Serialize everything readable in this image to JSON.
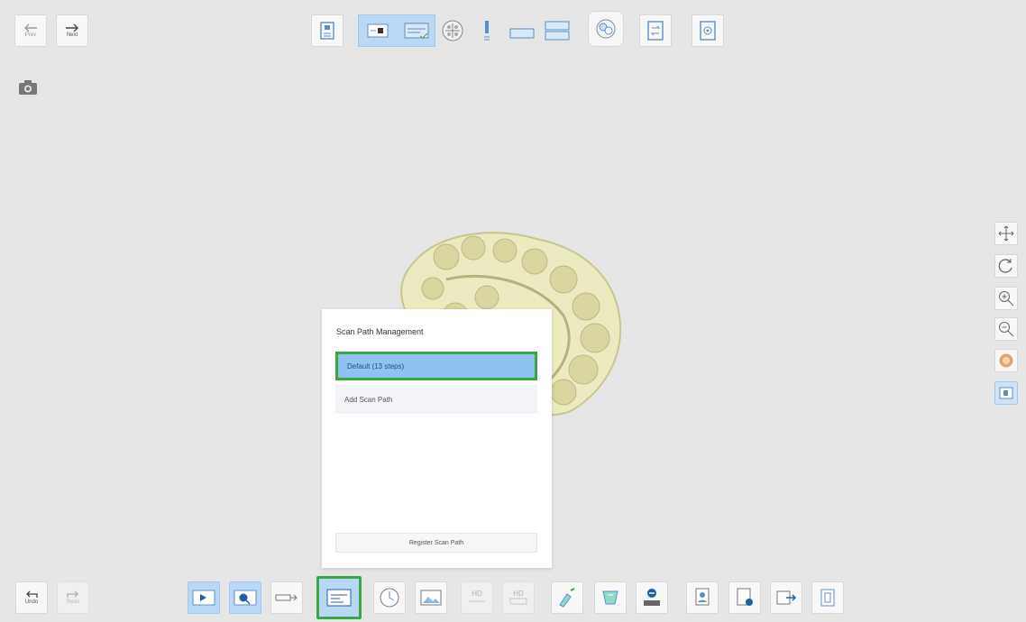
{
  "nav": {
    "prev_label": "Prev",
    "next_label": "Next"
  },
  "top_toolbar": {
    "items": [
      {
        "icon": "scan-info-icon"
      },
      {
        "icon": "single-view-icon",
        "active": true
      },
      {
        "icon": "dual-view-icon",
        "active": true
      },
      {
        "icon": "occlusion-icon"
      },
      {
        "icon": "vertical-bar-icon"
      },
      {
        "icon": "single-jaw-icon"
      },
      {
        "icon": "double-jaw-icon"
      },
      {
        "icon": "scan-align-icon"
      },
      {
        "icon": "swap-icon"
      },
      {
        "icon": "settings-clipboard-icon"
      }
    ]
  },
  "right_toolbar": {
    "items": [
      {
        "icon": "pan-icon"
      },
      {
        "icon": "rotate-icon"
      },
      {
        "icon": "zoom-in-icon"
      },
      {
        "icon": "zoom-out-icon"
      },
      {
        "icon": "texture-icon"
      },
      {
        "icon": "view-mode-icon",
        "active": true
      }
    ]
  },
  "bottom_toolbar": {
    "undo_label": "Undo",
    "redo_label": "Redo",
    "items": [
      {
        "icon": "play-scan-icon",
        "active": true
      },
      {
        "icon": "scan-filter-icon",
        "active": true
      },
      {
        "icon": "arrow-flow-icon"
      },
      {
        "icon": "scan-path-icon",
        "highlighted": true
      },
      {
        "icon": "timer-icon"
      },
      {
        "icon": "image-icon"
      },
      {
        "icon": "hd-icon",
        "label": "HD",
        "disabled": true
      },
      {
        "icon": "hd-plus-icon",
        "label": "HD",
        "disabled": true
      },
      {
        "icon": "trim-icon"
      },
      {
        "icon": "lock-icon"
      },
      {
        "icon": "minus-icon"
      },
      {
        "icon": "user-icon"
      },
      {
        "icon": "report-icon"
      },
      {
        "icon": "file-settings-icon"
      },
      {
        "icon": "export-icon"
      },
      {
        "icon": "delete-icon"
      }
    ]
  },
  "panel": {
    "title": "Scan Path Management",
    "paths": [
      {
        "label": "Default (13 steps)",
        "selected": true
      },
      {
        "label": "Add Scan Path"
      }
    ],
    "register_label": "Register Scan Path"
  },
  "colors": {
    "background": "#e6e6e6",
    "accent_blue": "#8ec2f1",
    "highlight_green": "#3aa743",
    "model": "#ecebbf"
  }
}
